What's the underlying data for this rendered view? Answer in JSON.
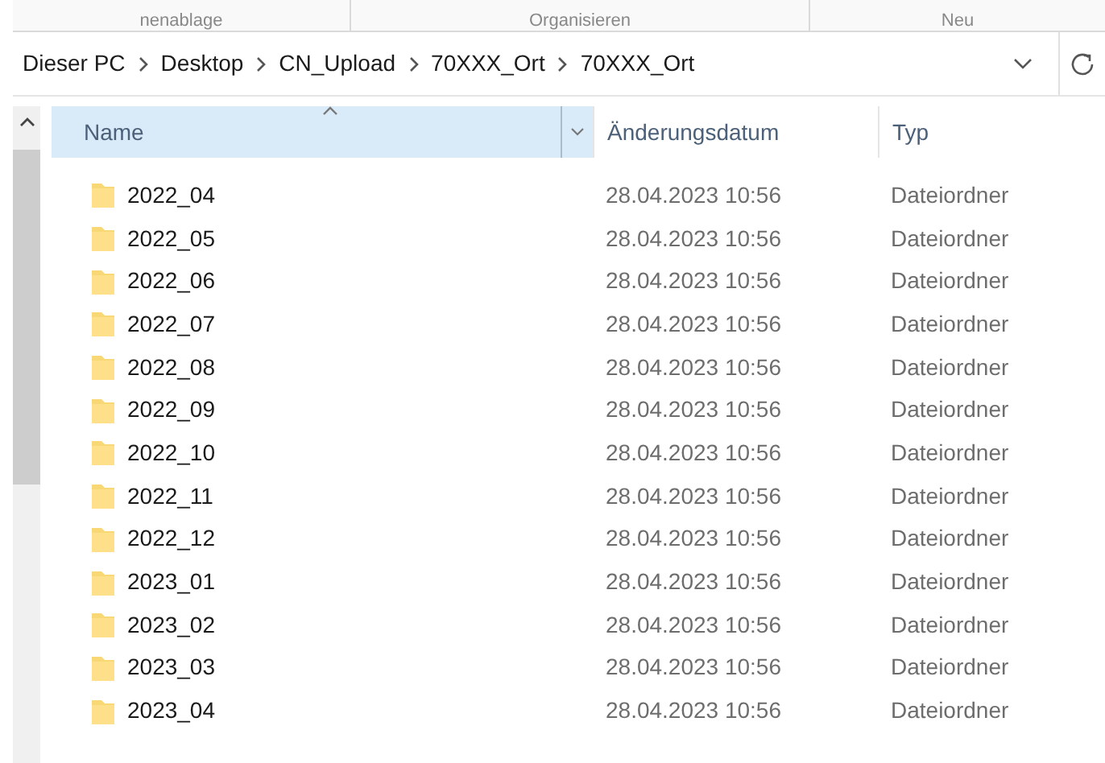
{
  "ribbon_groups": [
    "nenablage",
    "Organisieren",
    "Neu"
  ],
  "address_bar": {
    "path": [
      "Dieser PC",
      "Desktop",
      "CN_Upload",
      "70XXX_Ort",
      "70XXX_Ort"
    ]
  },
  "table": {
    "columns": [
      {
        "label": "Name",
        "sorted": true
      },
      {
        "label": "Änderungsdatum",
        "sorted": false
      },
      {
        "label": "Typ",
        "sorted": false
      }
    ],
    "rows": [
      {
        "name": "2022_04",
        "modified": "28.04.2023 10:56",
        "type": "Dateiordner"
      },
      {
        "name": "2022_05",
        "modified": "28.04.2023 10:56",
        "type": "Dateiordner"
      },
      {
        "name": "2022_06",
        "modified": "28.04.2023 10:56",
        "type": "Dateiordner"
      },
      {
        "name": "2022_07",
        "modified": "28.04.2023 10:56",
        "type": "Dateiordner"
      },
      {
        "name": "2022_08",
        "modified": "28.04.2023 10:56",
        "type": "Dateiordner"
      },
      {
        "name": "2022_09",
        "modified": "28.04.2023 10:56",
        "type": "Dateiordner"
      },
      {
        "name": "2022_10",
        "modified": "28.04.2023 10:56",
        "type": "Dateiordner"
      },
      {
        "name": "2022_11",
        "modified": "28.04.2023 10:56",
        "type": "Dateiordner"
      },
      {
        "name": "2022_12",
        "modified": "28.04.2023 10:56",
        "type": "Dateiordner"
      },
      {
        "name": "2023_01",
        "modified": "28.04.2023 10:56",
        "type": "Dateiordner"
      },
      {
        "name": "2023_02",
        "modified": "28.04.2023 10:56",
        "type": "Dateiordner"
      },
      {
        "name": "2023_03",
        "modified": "28.04.2023 10:56",
        "type": "Dateiordner"
      },
      {
        "name": "2023_04",
        "modified": "28.04.2023 10:56",
        "type": "Dateiordner"
      }
    ]
  }
}
